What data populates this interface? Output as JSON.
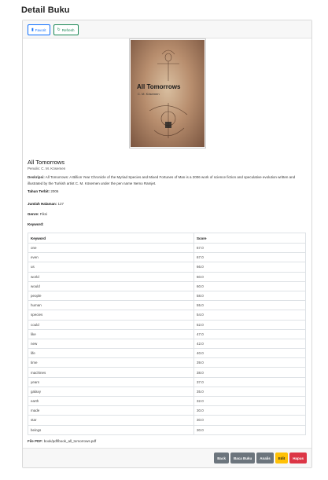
{
  "page": {
    "title": "Detail Buku"
  },
  "toolbar": {
    "favorite_label": "Favorit",
    "refresh_label": "Refresh"
  },
  "book": {
    "cover_title": "All Tomorrows",
    "cover_author": "C. M. Kösemen",
    "title": "All Tomorrows",
    "author": "Penulis: C. M. Kösemen",
    "description_label": "Deskripsi:",
    "description": "All Tomorrows: A Billion Year Chronicle of the Myriad Species and Mixed Fortunes of Man is a 2006 work of science fiction and speculative evolution written and illustrated by the Turkish artist C. M. Kösemen under the pen name Nemo Ramjet.",
    "year_label": "Tahun Terbit:",
    "year": "2006",
    "pages_label": "Jumlah Halaman:",
    "pages": "127",
    "genre_label": "Genre:",
    "genre": "Fiksi",
    "keyword_label": "Keyword:",
    "pdf_label": "File PDF:",
    "pdf_path": "book/pdf/book_all_tomorrows.pdf"
  },
  "keywords": {
    "headers": [
      "Keyword",
      "Score"
    ],
    "rows": [
      [
        "one",
        "67.0"
      ],
      [
        "even",
        "67.0"
      ],
      [
        "us",
        "66.0"
      ],
      [
        "world",
        "60.0"
      ],
      [
        "would",
        "60.0"
      ],
      [
        "people",
        "58.0"
      ],
      [
        "human",
        "55.0"
      ],
      [
        "species",
        "54.0"
      ],
      [
        "could",
        "52.0"
      ],
      [
        "like",
        "47.0"
      ],
      [
        "new",
        "42.0"
      ],
      [
        "life",
        "40.0"
      ],
      [
        "time",
        "39.0"
      ],
      [
        "machines",
        "38.0"
      ],
      [
        "years",
        "37.0"
      ],
      [
        "galaxy",
        "35.0"
      ],
      [
        "earth",
        "32.0"
      ],
      [
        "made",
        "30.0"
      ],
      [
        "star",
        "30.0"
      ],
      [
        "beings",
        "30.0"
      ]
    ]
  },
  "actions": {
    "back": "Back",
    "read": "Baca Buku",
    "analyze": "Analis",
    "edit": "Edit",
    "delete": "Hapus"
  }
}
